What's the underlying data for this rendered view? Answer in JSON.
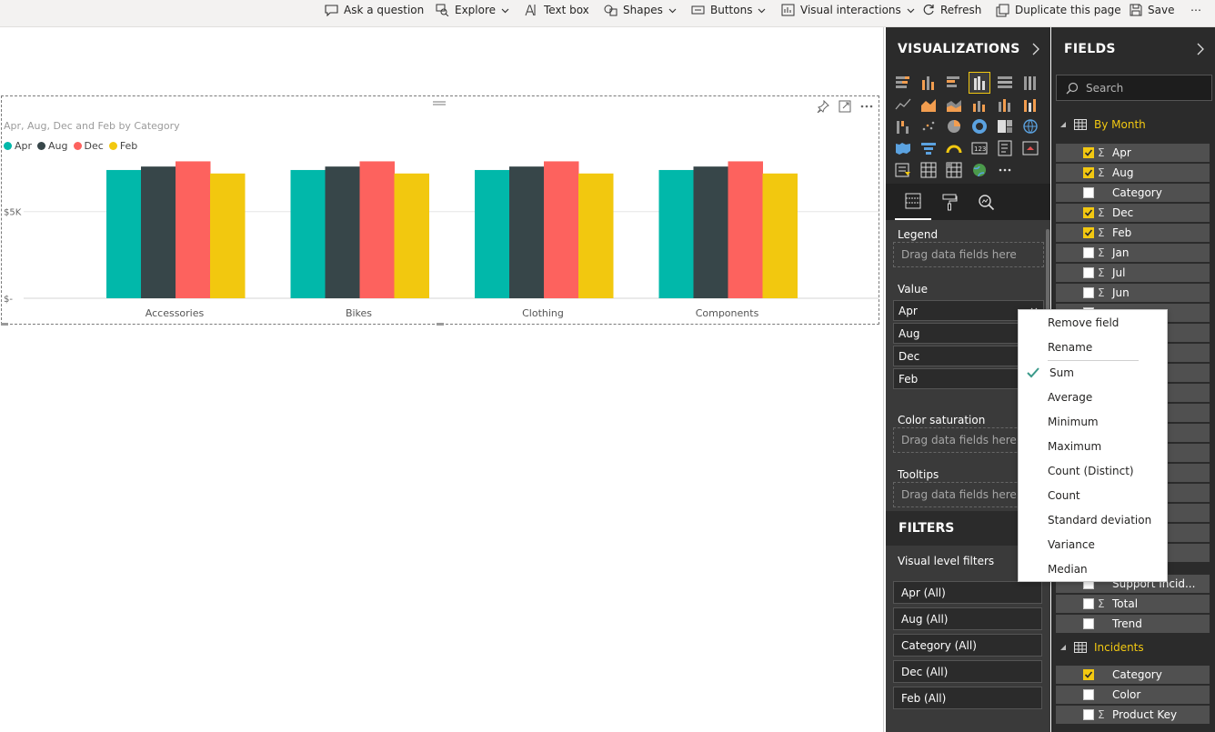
{
  "toolbar": {
    "items": [
      {
        "label": "Ask a question",
        "icon": "speech-bubble-icon"
      },
      {
        "label": "Explore",
        "icon": "explore-icon"
      },
      {
        "label": "Text box",
        "icon": "text-box-icon"
      },
      {
        "label": "Shapes",
        "icon": "shapes-icon"
      },
      {
        "label": "Buttons",
        "icon": "buttons-icon"
      },
      {
        "label": "Visual interactions",
        "icon": "visual-interactions-icon"
      },
      {
        "label": "Refresh",
        "icon": "refresh-icon"
      },
      {
        "label": "Duplicate this page",
        "icon": "duplicate-icon"
      },
      {
        "label": "Save",
        "icon": "save-icon"
      }
    ],
    "more": "⋯"
  },
  "visual": {
    "title": "Apr, Aug, Dec and Feb by Category"
  },
  "chart_data": {
    "type": "bar",
    "title": "Apr, Aug, Dec and Feb by Category",
    "categories": [
      "Accessories",
      "Bikes",
      "Clothing",
      "Components"
    ],
    "series": [
      {
        "name": "Apr",
        "color": "#01b8aa",
        "values": [
          7400,
          7400,
          7400,
          7400
        ]
      },
      {
        "name": "Aug",
        "color": "#374649",
        "values": [
          7600,
          7600,
          7600,
          7600
        ]
      },
      {
        "name": "Dec",
        "color": "#fd625e",
        "values": [
          7900,
          7900,
          7900,
          7900
        ]
      },
      {
        "name": "Feb",
        "color": "#f2c80f",
        "values": [
          7200,
          7200,
          7200,
          7200
        ]
      }
    ],
    "ytick_labels": [
      "$-",
      "$5K"
    ],
    "yticks": [
      0,
      5000
    ],
    "ylim": [
      0,
      8500
    ],
    "grid": true,
    "legend": "top-left"
  },
  "visualizations": {
    "title": "VISUALIZATIONS",
    "legend_label": "Legend",
    "value_label": "Value",
    "color_saturation_label": "Color saturation",
    "tooltips_label": "Tooltips",
    "drop_placeholder": "Drag data fields here",
    "value_fields": [
      "Apr",
      "Aug",
      "Dec",
      "Feb"
    ]
  },
  "filters": {
    "title": "FILTERS",
    "section_label": "Visual level filters",
    "items": [
      "Apr (All)",
      "Aug (All)",
      "Category (All)",
      "Dec (All)",
      "Feb (All)"
    ]
  },
  "fields": {
    "title": "FIELDS",
    "search_placeholder": "Search",
    "table1": "By Month",
    "table1_fields": [
      {
        "name": "Apr",
        "checked": true,
        "sigma": true
      },
      {
        "name": "Aug",
        "checked": true,
        "sigma": true
      },
      {
        "name": "Category",
        "checked": false,
        "sigma": false
      },
      {
        "name": "Dec",
        "checked": true,
        "sigma": true
      },
      {
        "name": "Feb",
        "checked": true,
        "sigma": true
      },
      {
        "name": "Jan",
        "checked": false,
        "sigma": true
      },
      {
        "name": "Jul",
        "checked": false,
        "sigma": true
      },
      {
        "name": "Jun",
        "checked": false,
        "sigma": true
      }
    ],
    "table1_lower_fields": [
      {
        "name": "Support Incid...",
        "checked": false,
        "sigma": false
      },
      {
        "name": "Total",
        "checked": false,
        "sigma": true
      },
      {
        "name": "Trend",
        "checked": false,
        "sigma": false
      }
    ],
    "table2": "Incidents",
    "table2_fields": [
      {
        "name": "Category",
        "checked": true,
        "sigma": false
      },
      {
        "name": "Color",
        "checked": false,
        "sigma": false
      },
      {
        "name": "Product Key",
        "checked": false,
        "sigma": true
      }
    ]
  },
  "context_menu": {
    "items": [
      "Remove field",
      "Rename",
      "Sum",
      "Average",
      "Minimum",
      "Maximum",
      "Count (Distinct)",
      "Count",
      "Standard deviation",
      "Variance",
      "Median"
    ],
    "checked": "Sum"
  },
  "colors": {
    "accent": "#f2c811",
    "pane_bg": "#2b2b2b",
    "check": "#3a9a8a"
  }
}
